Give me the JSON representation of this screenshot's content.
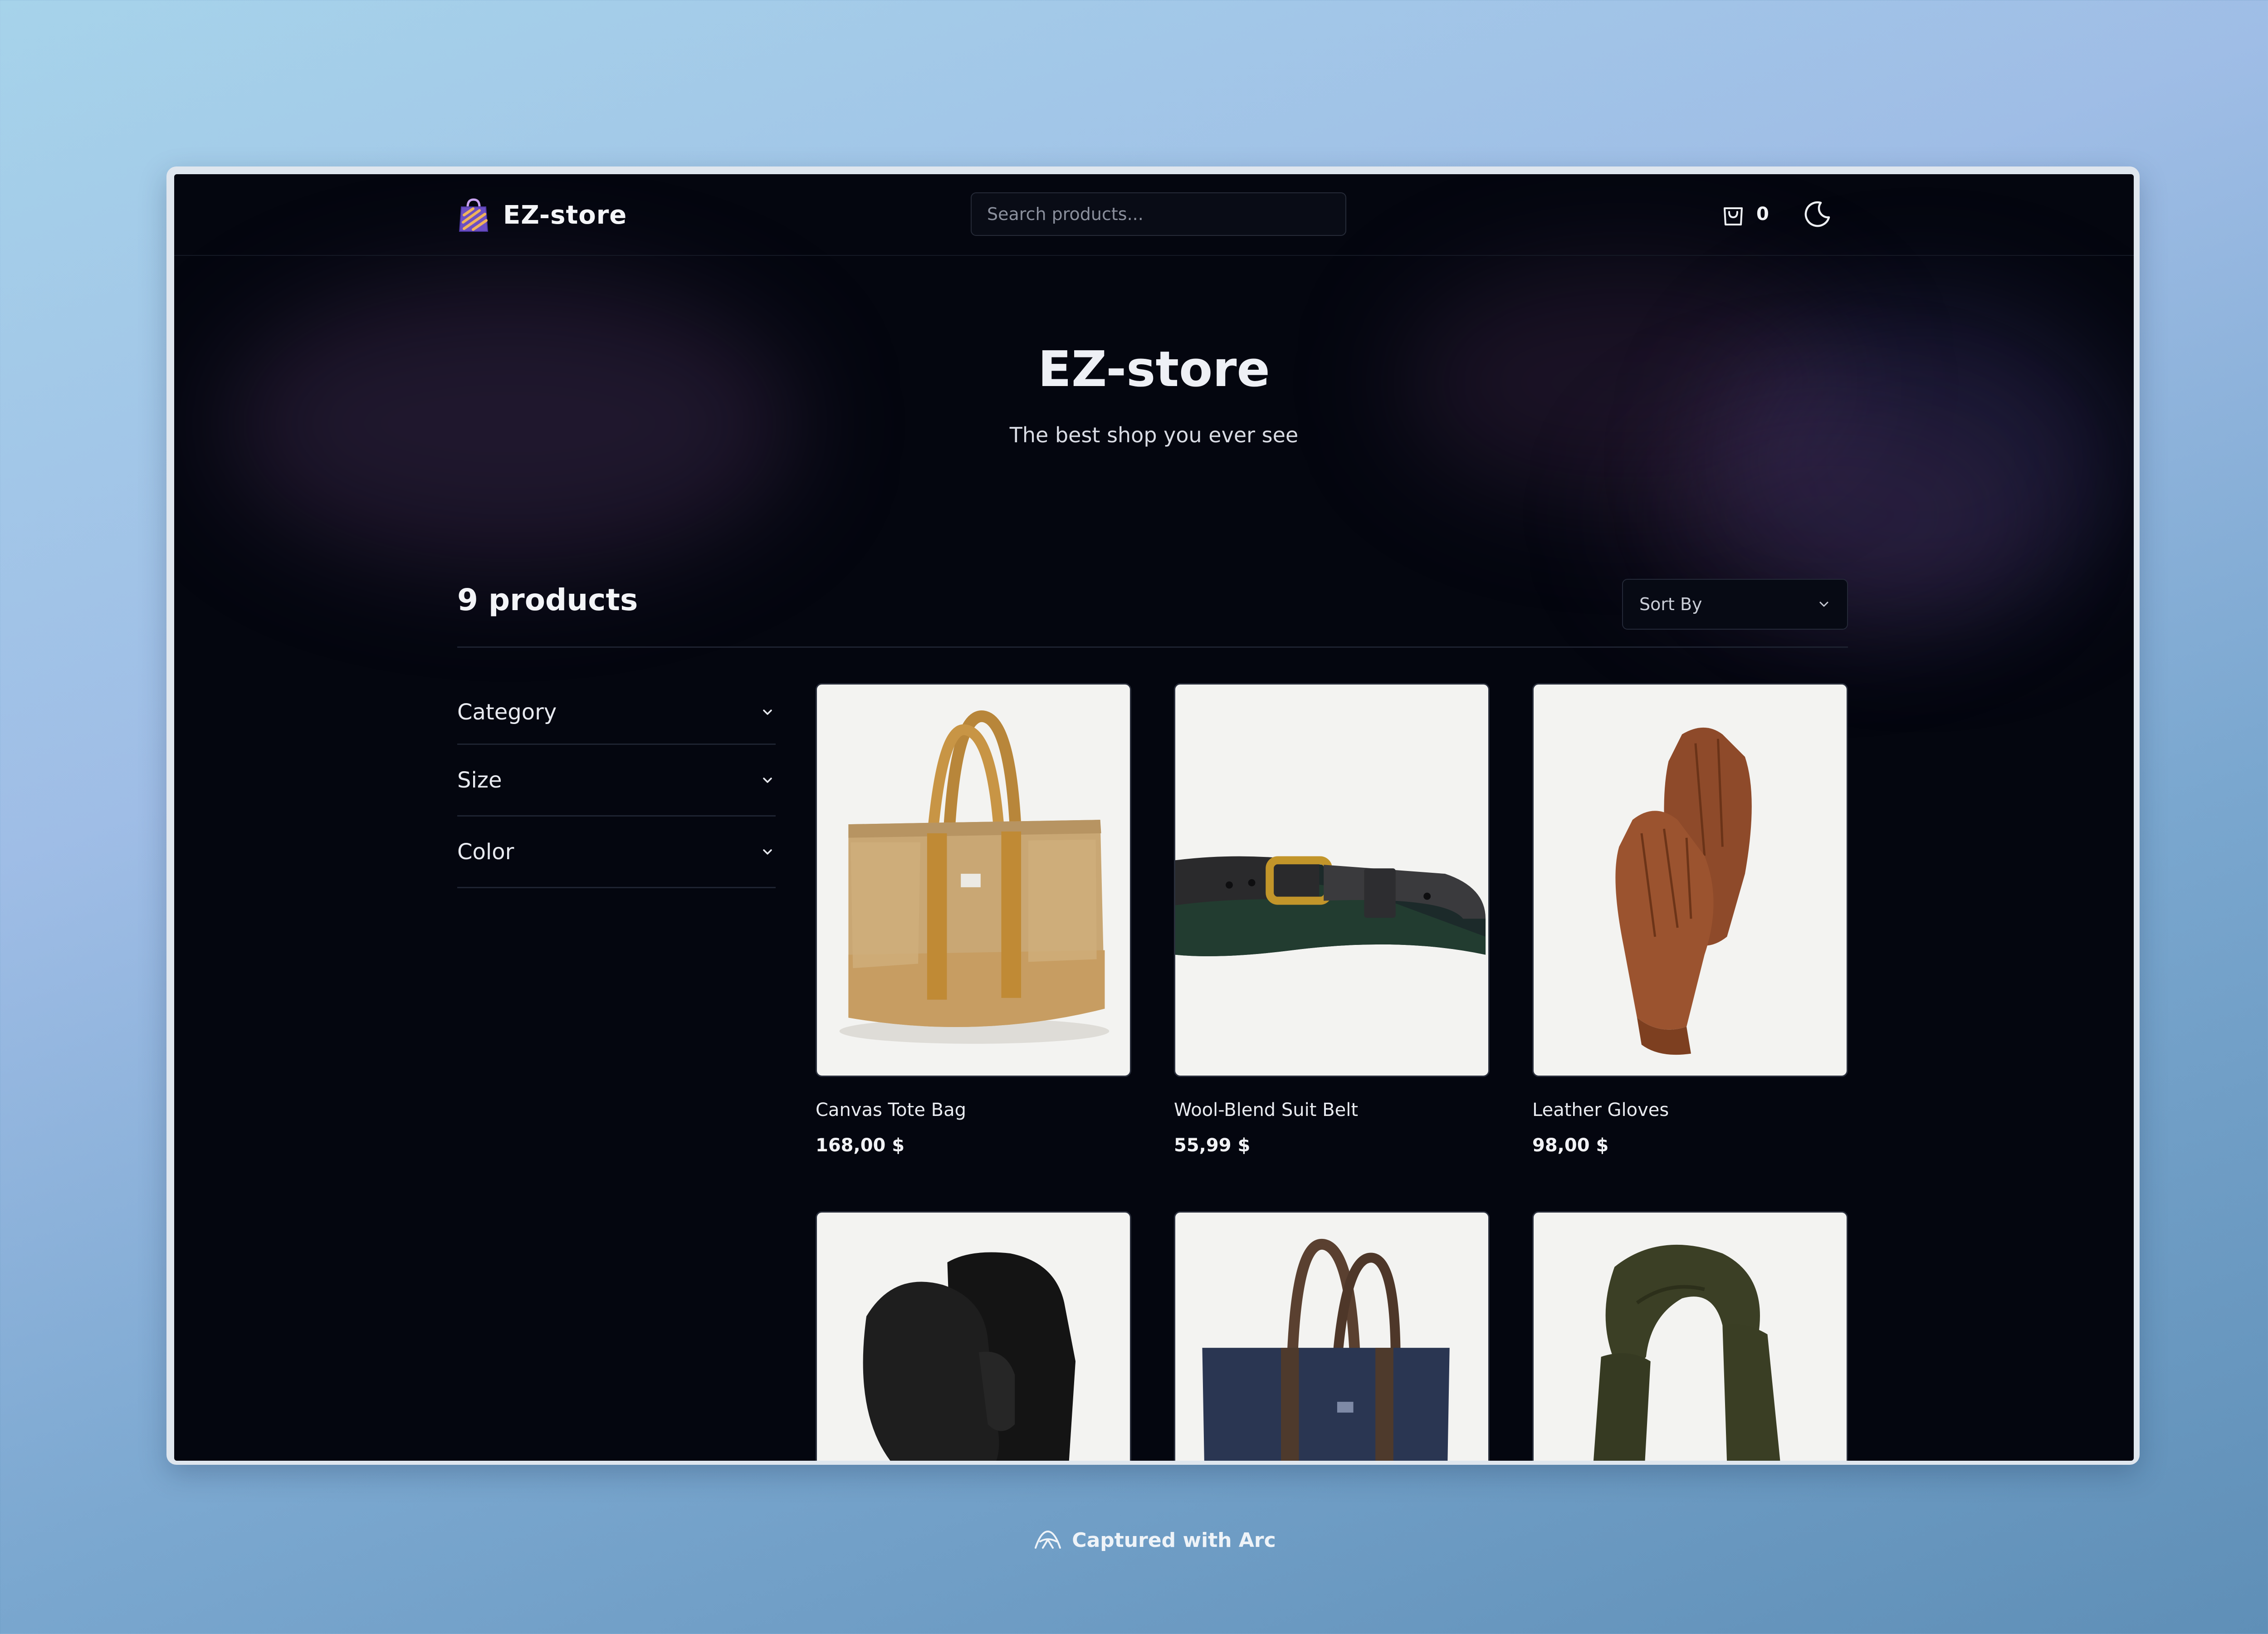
{
  "app": {
    "name": "EZ-store"
  },
  "search": {
    "placeholder": "Search products..."
  },
  "cart": {
    "count": "0"
  },
  "hero": {
    "title": "EZ-store",
    "subtitle": "The best shop you ever see"
  },
  "listing": {
    "count_label": "9 products",
    "sort_label": "Sort By"
  },
  "filters": [
    {
      "label": "Category"
    },
    {
      "label": "Size"
    },
    {
      "label": "Color"
    }
  ],
  "products": [
    {
      "name": "Canvas Tote Bag",
      "price": "168,00 $",
      "image": "tan-canvas-tote-bag"
    },
    {
      "name": "Wool-Blend Suit Belt",
      "price": "55,99 $",
      "image": "plaid-belt-gold-buckle"
    },
    {
      "name": "Leather Gloves",
      "price": "98,00 $",
      "image": "brown-leather-gloves"
    },
    {
      "name": "",
      "price": "",
      "image": "black-mittens"
    },
    {
      "name": "",
      "price": "",
      "image": "navy-tote-bag"
    },
    {
      "name": "",
      "price": "",
      "image": "olive-knit-scarf"
    }
  ],
  "footer": {
    "capture_label": "Captured with Arc"
  },
  "colors": {
    "background": "#04060f",
    "accent": "#7b5cc9"
  }
}
